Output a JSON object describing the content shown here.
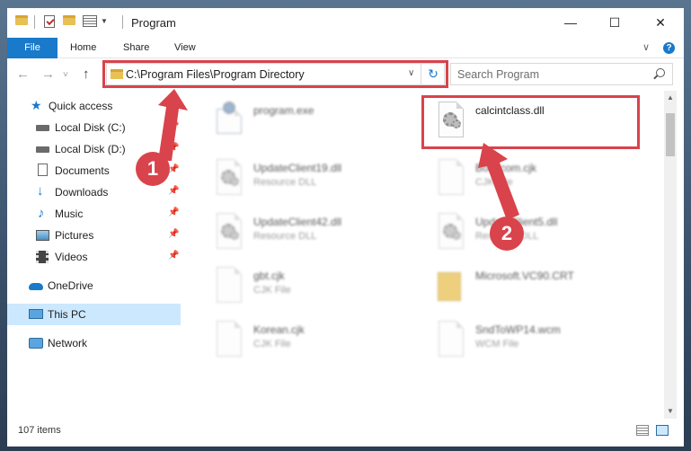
{
  "window": {
    "title": "Program",
    "controls": {
      "minimize": "—",
      "maximize": "☐",
      "close": "✕"
    }
  },
  "ribbon": {
    "tabs": [
      "File",
      "Home",
      "Share",
      "View"
    ],
    "expand_icon": "chevron-down-icon",
    "help_icon": "?"
  },
  "address": {
    "path": "C:\\Program Files\\Program Directory",
    "dropdown_icon": "∨",
    "refresh_icon": "↻"
  },
  "nav_buttons": {
    "back": "←",
    "forward": "→",
    "recent": "˅",
    "up": "↑"
  },
  "search": {
    "placeholder": "Search Program"
  },
  "sidebar": {
    "items": [
      {
        "label": "Quick access",
        "icon": "star-icon",
        "pinned": false
      },
      {
        "label": "Local Disk (C:)",
        "icon": "drive-icon",
        "pinned": true
      },
      {
        "label": "Local Disk (D:)",
        "icon": "drive-icon",
        "pinned": true
      },
      {
        "label": "Documents",
        "icon": "document-icon",
        "pinned": true
      },
      {
        "label": "Downloads",
        "icon": "download-icon",
        "pinned": true
      },
      {
        "label": "Music",
        "icon": "music-icon",
        "pinned": true
      },
      {
        "label": "Pictures",
        "icon": "pictures-icon",
        "pinned": true
      },
      {
        "label": "Videos",
        "icon": "videos-icon",
        "pinned": true
      },
      {
        "label": "OneDrive",
        "icon": "cloud-icon",
        "pinned": false
      },
      {
        "label": "This PC",
        "icon": "computer-icon",
        "pinned": false,
        "selected": true
      },
      {
        "label": "Network",
        "icon": "network-icon",
        "pinned": false
      }
    ],
    "pin_glyph": "📌"
  },
  "files": [
    {
      "name": "program.exe",
      "desc": "",
      "type": "exe",
      "highlighted": false
    },
    {
      "name": "calcintclass.dll",
      "desc": "",
      "type": "dll",
      "highlighted": true
    },
    {
      "name": "UpdateClient19.dll",
      "desc": "Resource DLL",
      "type": "dll",
      "highlighted": false
    },
    {
      "name": "Bookcom.cjk",
      "desc": "CJK File",
      "type": "doc",
      "highlighted": false
    },
    {
      "name": "UpdateClient42.dll",
      "desc": "Resource DLL",
      "type": "dll",
      "highlighted": false
    },
    {
      "name": "UpdateClient5.dll",
      "desc": "Resource DLL",
      "type": "dll",
      "highlighted": false
    },
    {
      "name": "gbt.cjk",
      "desc": "CJK File",
      "type": "doc",
      "highlighted": false
    },
    {
      "name": "Microsoft.VC90.CRT",
      "desc": "",
      "type": "folder",
      "highlighted": false
    },
    {
      "name": "Korean.cjk",
      "desc": "CJK File",
      "type": "doc",
      "highlighted": false
    },
    {
      "name": "SndToWP14.wcm",
      "desc": "WCM File",
      "type": "doc",
      "highlighted": false
    }
  ],
  "status": {
    "item_count": "107 items"
  },
  "annotations": {
    "step1": "1",
    "step2": "2",
    "color": "#d9434b"
  },
  "colors": {
    "accent": "#1979ca",
    "selected_bg": "#cce8ff"
  }
}
